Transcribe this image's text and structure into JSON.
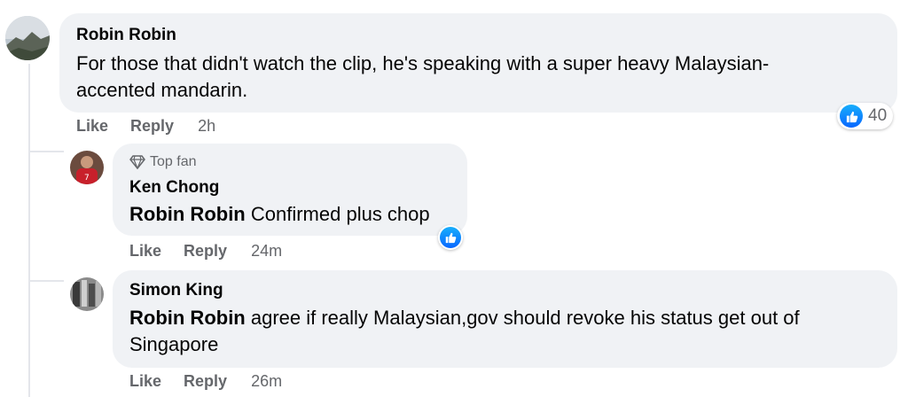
{
  "comments": [
    {
      "author": "Robin Robin",
      "text_line1": "For those that didn't watch the clip, he's speaking with a super heavy Malaysian-",
      "text_line2": "accented mandarin.",
      "like_label": "Like",
      "reply_label": "Reply",
      "time": "2h",
      "reaction_count": "40"
    }
  ],
  "replies": [
    {
      "badge": "Top fan",
      "author": "Ken Chong",
      "mention": "Robin Robin",
      "text": " Confirmed plus chop",
      "like_label": "Like",
      "reply_label": "Reply",
      "time": "24m"
    },
    {
      "author": "Simon King",
      "mention": "Robin Robin",
      "text_line1": " agree if really Malaysian,gov should revoke his status get out of",
      "text_line2": "Singapore",
      "like_label": "Like",
      "reply_label": "Reply",
      "time": "26m"
    }
  ],
  "colors": {
    "bubble": "#f0f2f5",
    "secondary_text": "#65676b",
    "like_blue": "#0866ff"
  }
}
